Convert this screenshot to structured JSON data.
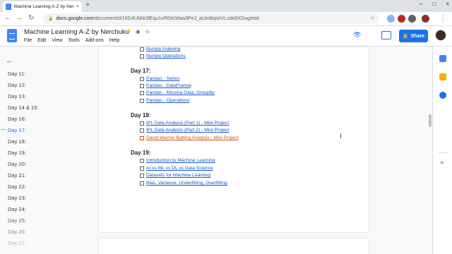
{
  "browser": {
    "tab_title": "Machine Learning A-Z by Nerchuko",
    "tab_close": "×",
    "new_tab": "+",
    "window_controls": [
      "–",
      "□",
      "×"
    ],
    "url_host": "docs.google.com",
    "url_path": "/document/d/16G4UMib3lEqu1vR0dcWaa3PeJ_aUmBqseVLzde8XDug/edit"
  },
  "docs": {
    "title": "Machine Learning A-Z by Nerchuko",
    "menu": [
      "File",
      "Edit",
      "View",
      "Tools",
      "Add-ons",
      "Help"
    ],
    "share_label": "Share"
  },
  "outline": {
    "items": [
      "Day 11:",
      "Day 12:",
      "Day 13:",
      "Day 14 & 15:",
      "Day 16:",
      "Day 17:",
      "Day 18:",
      "Day 19:",
      "Day 20:",
      "Day 21:",
      "Day 22:",
      "Day 23:",
      "Day 24:",
      "Day 25:",
      "Day 26:",
      "Day 27:"
    ],
    "active_index": 5
  },
  "document": {
    "top_items": [
      "Numpy Indexing",
      "Numpy Operations"
    ],
    "day17": {
      "heading": "Day 17:",
      "items": [
        "Pandas - Series",
        "Pandas - DataFrame",
        "Pandas - Missing Data, Groupby",
        "Pandas - Operations"
      ]
    },
    "day18": {
      "heading": "Day 18:",
      "items": [
        "IPL Data Analysis (Part 1) - Mini Project",
        "IPL Data Analysis (Part 2) - Mini Project",
        "David Warner Batting Analysis - Mini Project"
      ]
    },
    "day19": {
      "heading": "Day 19:",
      "items": [
        "Introduction to Machine Learning",
        "AI vs ML vs DL vs Data Science",
        "Datasets for Machine Learning",
        "Bias, Variance, Underfitting, Overfitting"
      ]
    }
  },
  "colors": {
    "accent": "#1a73e8",
    "link": "#1155cc",
    "visited_link": "#c5521e"
  }
}
